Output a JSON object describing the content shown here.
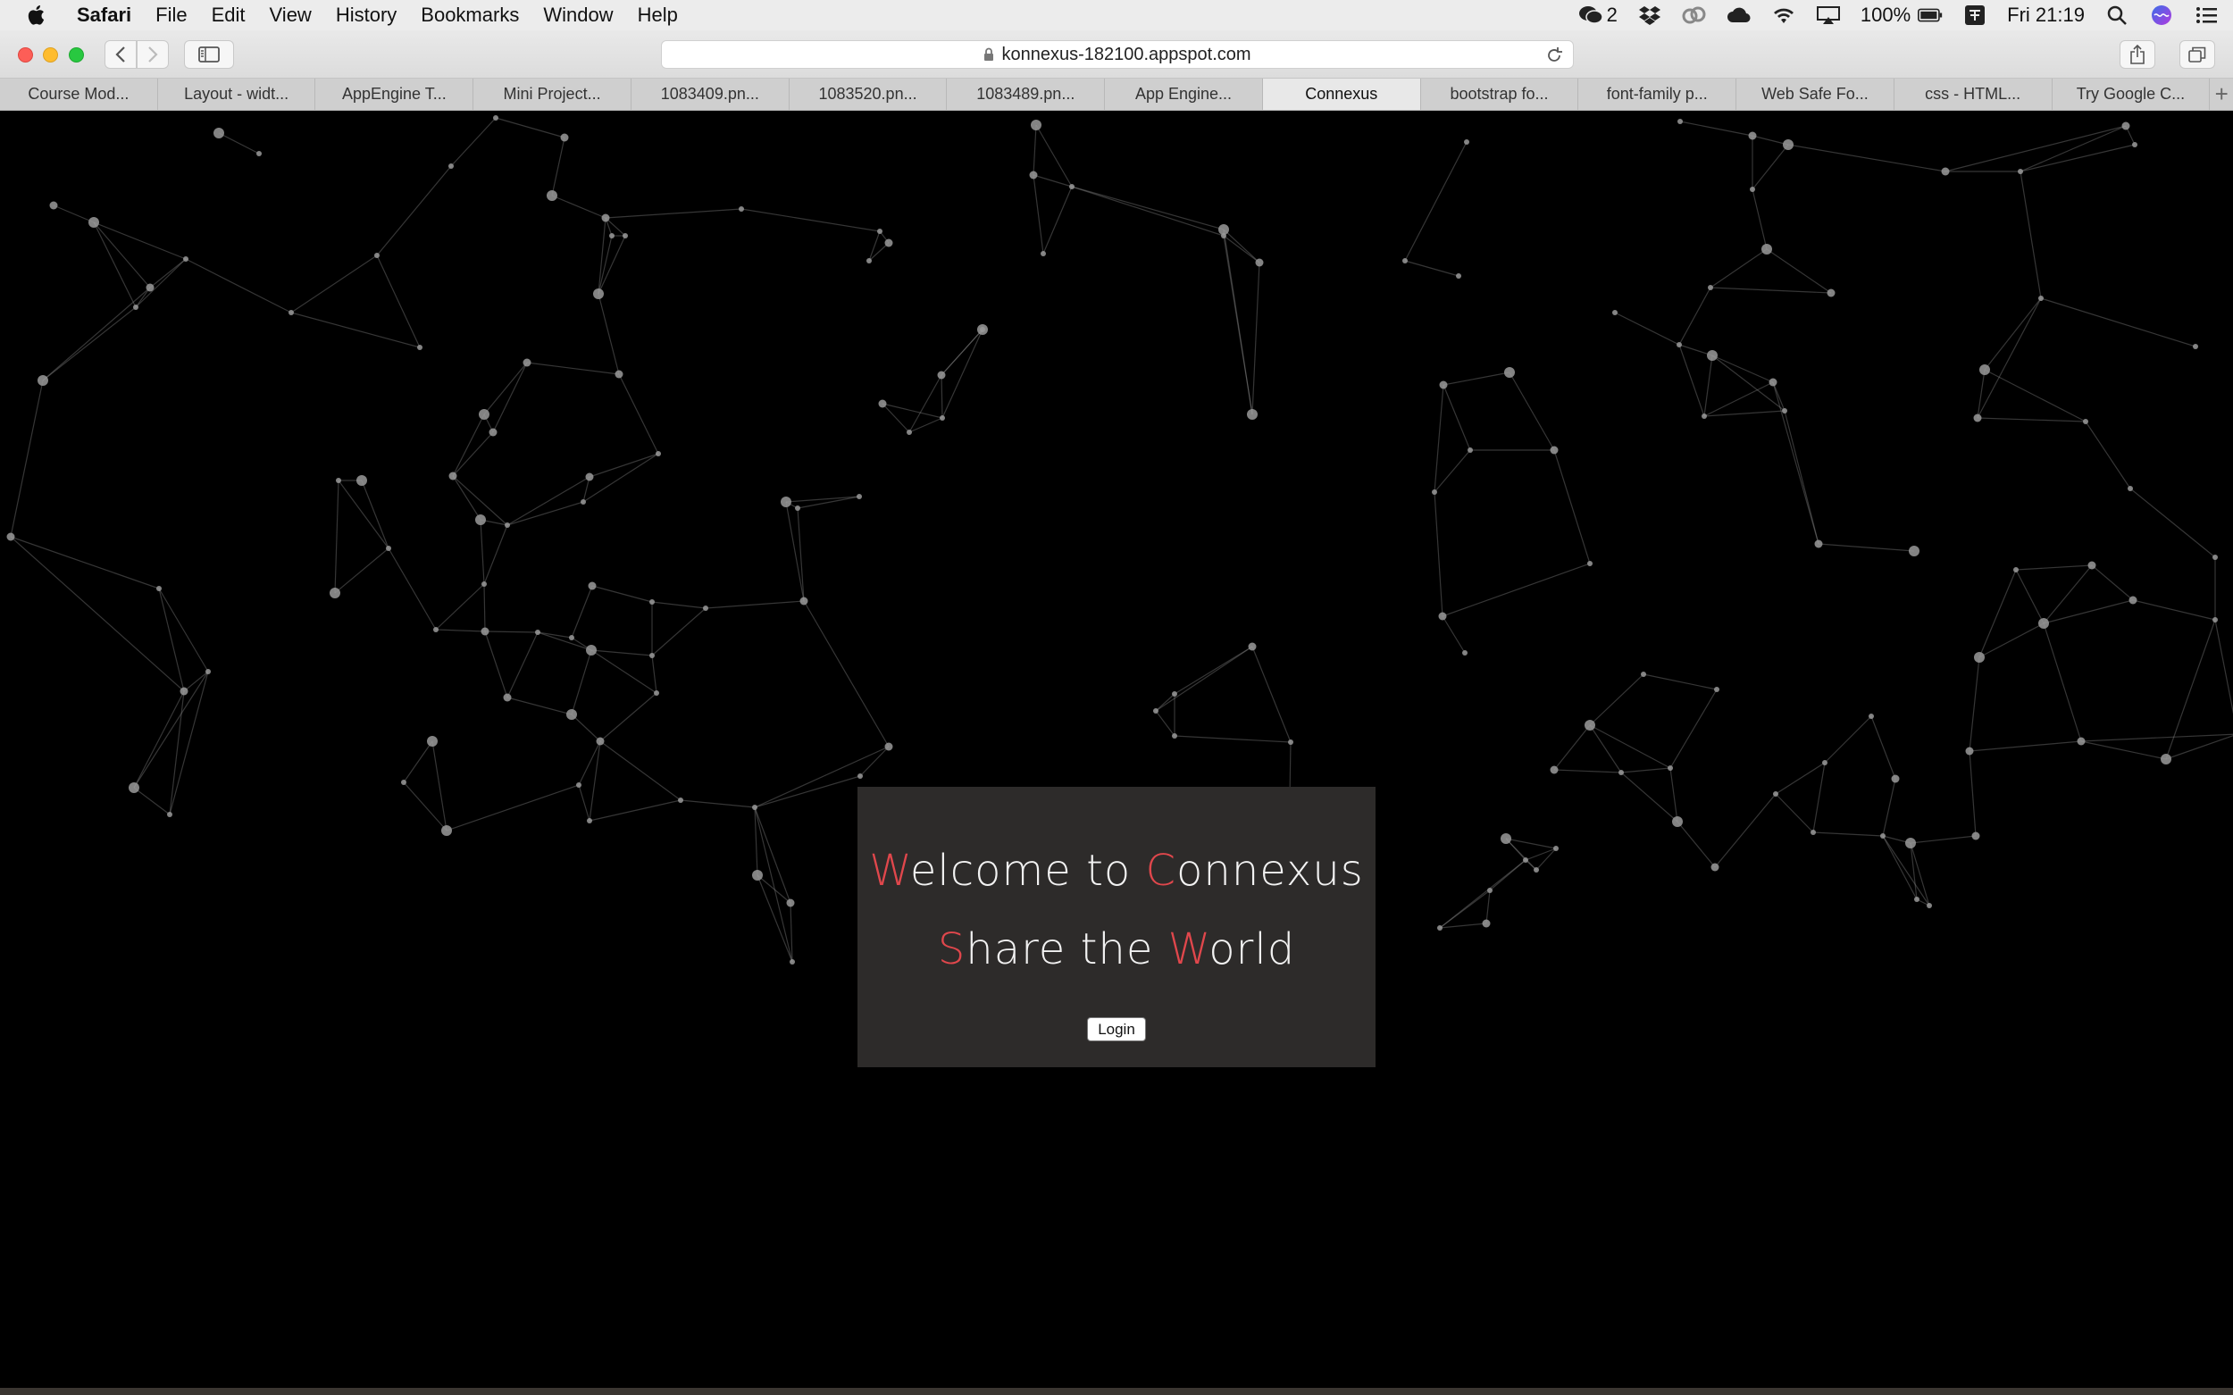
{
  "menubar": {
    "app": "Safari",
    "items": [
      "File",
      "Edit",
      "View",
      "History",
      "Bookmarks",
      "Window",
      "Help"
    ],
    "status": {
      "wechat_count": "2",
      "battery": "100%",
      "clock": "Fri 21:19",
      "icons": [
        "wechat-icon",
        "dropbox-icon",
        "creative-cloud-icon",
        "cloud-icon",
        "wifi-icon",
        "airplay-icon",
        "battery-icon",
        "input-method-icon",
        "spotlight-icon",
        "siri-icon",
        "notification-center-icon"
      ]
    }
  },
  "toolbar": {
    "address": "konnexus-182100.appspot.com"
  },
  "tabs": [
    {
      "label": "Course Mod..."
    },
    {
      "label": "Layout - widt..."
    },
    {
      "label": "AppEngine T..."
    },
    {
      "label": "Mini Project..."
    },
    {
      "label": "1083409.pn..."
    },
    {
      "label": "1083520.pn..."
    },
    {
      "label": "1083489.pn..."
    },
    {
      "label": "App Engine..."
    },
    {
      "label": "Connexus",
      "active": true
    },
    {
      "label": "bootstrap fo..."
    },
    {
      "label": "font-family p..."
    },
    {
      "label": "Web Safe Fo..."
    },
    {
      "label": "css - HTML..."
    },
    {
      "label": "Try Google C..."
    }
  ],
  "page": {
    "headline_1": {
      "accent_1": "W",
      "rest_1": "elcome to ",
      "accent_2": "C",
      "rest_2": "onnexus"
    },
    "headline_2": {
      "accent_1": "S",
      "rest_1": "hare the ",
      "accent_2": "W",
      "rest_2": "orld"
    },
    "login_label": "Login",
    "colors": {
      "accent": "#e0474c",
      "panel": "#2d2b2a",
      "background": "#000000",
      "network": "#9a9a9a"
    }
  }
}
